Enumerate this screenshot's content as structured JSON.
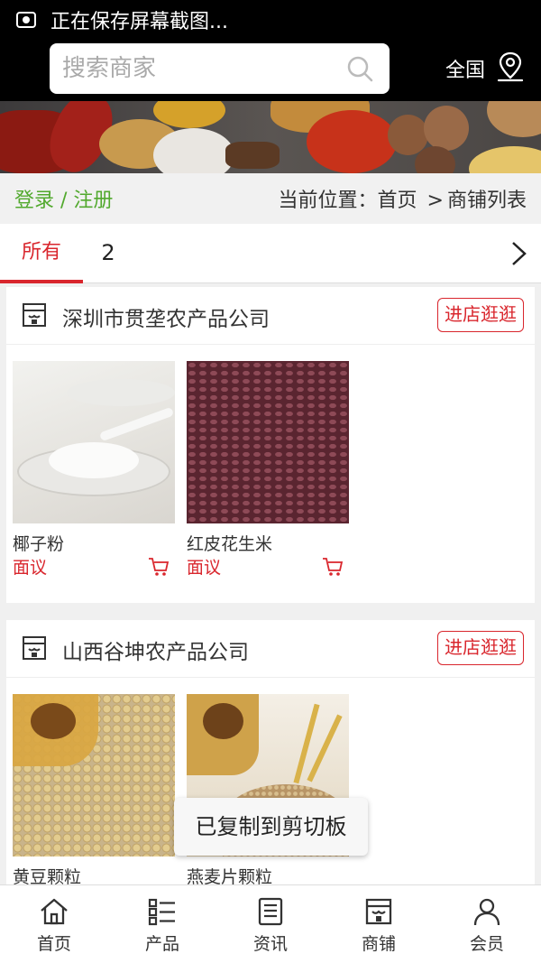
{
  "status_bar": {
    "text": "正在保存屏幕截图..."
  },
  "search": {
    "placeholder": "搜索商家",
    "region": "全国"
  },
  "nav_bar": {
    "auth": "登录 / 注册",
    "location_label": "当前位置：",
    "home": "首页",
    "separator": ">",
    "current": "商铺列表"
  },
  "tabs": [
    {
      "label": "所有"
    },
    {
      "label": "2"
    }
  ],
  "shops": [
    {
      "name": "深圳市贯垄农产品公司",
      "visit_label": "进店逛逛",
      "products": [
        {
          "name": "椰子粉",
          "price": "面议"
        },
        {
          "name": "红皮花生米",
          "price": "面议"
        }
      ]
    },
    {
      "name": "山西谷坤农产品公司",
      "visit_label": "进店逛逛",
      "products": [
        {
          "name": "黄豆颗粒",
          "price": ""
        },
        {
          "name": "燕麦片颗粒",
          "price": ""
        }
      ]
    }
  ],
  "toast": "已复制到剪切板",
  "bottom_nav": [
    {
      "label": "首页",
      "icon": "home-icon"
    },
    {
      "label": "产品",
      "icon": "list-icon"
    },
    {
      "label": "资讯",
      "icon": "news-icon"
    },
    {
      "label": "商铺",
      "icon": "shop-icon"
    },
    {
      "label": "会员",
      "icon": "user-icon"
    }
  ],
  "colors": {
    "accent": "#d9262d",
    "auth_green": "#52a92e",
    "header_bg": "#000000"
  }
}
